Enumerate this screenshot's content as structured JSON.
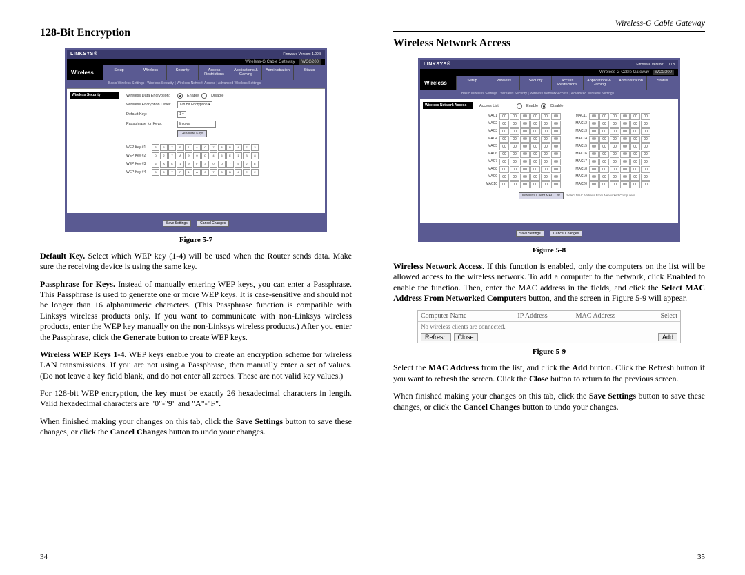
{
  "header": {
    "running": "Wireless-G Cable Gateway"
  },
  "left": {
    "title": "128-Bit Encryption",
    "fig_caption": "Figure 5-7",
    "p1a": "Default Key.",
    "p1b": " Select which WEP key (1-4) will be used when the Router sends data. Make sure the receiving device is using the same key.",
    "p2a": "Passphrase for Keys.",
    "p2b": " Instead of manually entering WEP keys, you can enter a Passphrase. This Passphrase is used to generate one or more WEP keys. It is case-sensitive and should not be longer than 16 alphanumeric characters. (This Passphrase function is compatible with Linksys wireless products only. If you want to communicate with non-Linksys wireless products, enter the WEP key manually on the non-Linksys wireless products.) After you enter the Passphrase, click the ",
    "p2c": "Generate",
    "p2d": " button to create WEP keys.",
    "p3a": "Wireless WEP Keys 1-4.",
    "p3b": " WEP keys enable you to create an encryption scheme for wireless LAN transmissions. If you are not using a Passphrase, then manually enter a set of values. (Do not leave a key field blank, and do not enter all zeroes. These are not valid key values.)",
    "p4": "For 128-bit WEP encryption, the key must be exactly 26 hexadecimal characters in length. Valid hexadecimal characters are \"0\"-\"9\" and \"A\"-\"F\".",
    "p5a": "When finished making your changes on this tab, click the ",
    "p5b": "Save Settings",
    "p5c": " button to save these changes, or click the ",
    "p5d": "Cancel Changes",
    "p5e": " button to undo your changes.",
    "page_num": "34"
  },
  "right": {
    "title": "Wireless Network Access",
    "fig8_caption": "Figure 5-8",
    "p1a": "Wireless Network Access.",
    "p1b": " If this function is enabled, only the computers on the list will be allowed access to the wireless network. To add a computer to the network, click ",
    "p1c": "Enabled",
    "p1d": " to enable the function. Then, enter the MAC address in the fields, and click the ",
    "p1e": "Select MAC Address From Networked Computers",
    "p1f": " button, and the screen in Figure 5-9 will appear.",
    "fig9_caption": "Figure 5-9",
    "p2a": "Select the ",
    "p2b": "MAC Address",
    "p2c": " from the list, and click the ",
    "p2d": "Add",
    "p2e": " button. Click the Refresh button if you want to refresh the screen. Click the ",
    "p2f": "Close",
    "p2g": " button to return to the previous screen.",
    "p3a": "When finished making your changes on this tab, click the ",
    "p3b": "Save Settings",
    "p3c": " button to save these changes, or click the ",
    "p3d": "Cancel Changes",
    "p3e": " button to undo your changes.",
    "page_num": "35"
  },
  "shot": {
    "logo": "LINKSYS®",
    "firmware": "Firmware Version: 1.00.8",
    "product": "Wireless-G Cable Gateway",
    "model": "WCG200",
    "section": "Wireless",
    "tabs": [
      "Setup",
      "Wireless",
      "Security",
      "Access Restrictions",
      "Applications & Gaming",
      "Administration",
      "Status"
    ],
    "subtabs7": "Basic Wireless Settings | Wireless Security | Wireless Network Access | Advanced Wireless Settings",
    "left7_label": "Wireless Security",
    "row_enc": "Wireless Data Encryption:",
    "enable": "Enable",
    "disable": "Disable",
    "row_level": "Wireless Encryption Level:",
    "level_val": "128 Bit Encryption",
    "row_defkey": "Default Key:",
    "defkey_val": "1",
    "row_pass": "Passphrase for Keys:",
    "pass_val": "linksys",
    "gen_btn": "Generate Keys",
    "wep_labels": [
      "WEP Key #1",
      "WEP Key #2",
      "WEP Key #3",
      "WEP Key #4"
    ],
    "save": "Save Settings",
    "cancel": "Cancel Changes",
    "left8_label": "Wireless Network Access",
    "access_label": "Access List:",
    "mac_labels_left": [
      "MAC1",
      "MAC2",
      "MAC3",
      "MAC4",
      "MAC5",
      "MAC6",
      "MAC7",
      "MAC8",
      "MAC9",
      "MAC10"
    ],
    "mac_labels_right": [
      "MAC11",
      "MAC12",
      "MAC13",
      "MAC14",
      "MAC15",
      "MAC16",
      "MAC17",
      "MAC18",
      "MAC19",
      "MAC20"
    ],
    "mac_val": "00",
    "select_mac_btn": "Wireless Client MAC List",
    "select_mac_note": "Select MAC Address From Networked Computers"
  },
  "fig9": {
    "h1": "Computer Name",
    "h2": "IP Address",
    "h3": "MAC Address",
    "h4": "Select",
    "empty": "No wireless clients are connected.",
    "refresh": "Refresh",
    "close": "Close",
    "add": "Add"
  }
}
